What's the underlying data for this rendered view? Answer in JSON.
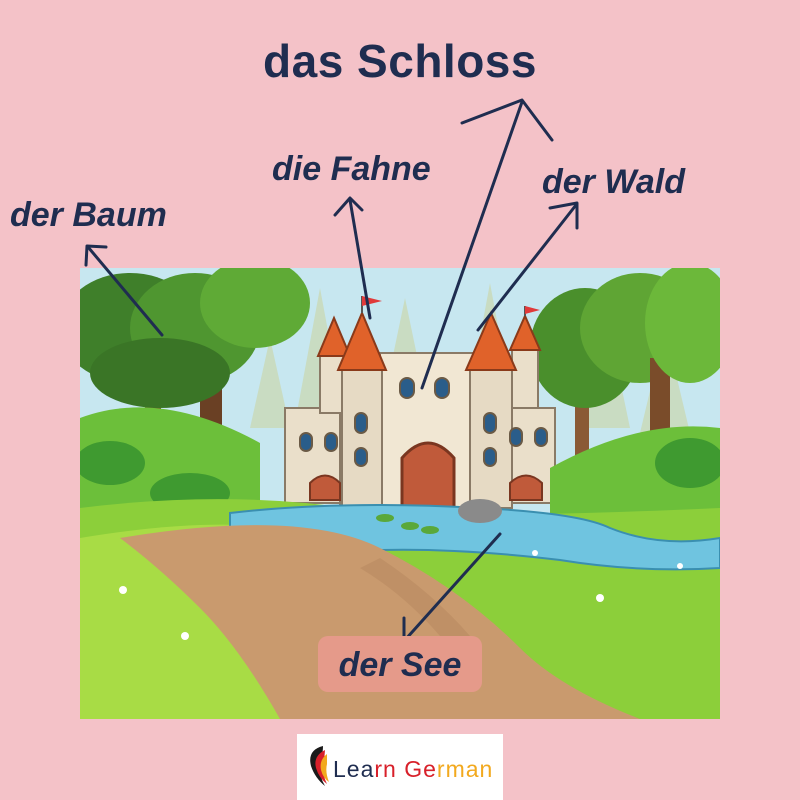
{
  "title": "das Schloss",
  "labels": {
    "flag": "die Fahne",
    "forest": "der Wald",
    "tree": "der Baum",
    "lake": "der See"
  },
  "logo": {
    "part1": "Lea",
    "part2": "rn Ge",
    "part3": "rman"
  },
  "colors": {
    "background": "#f4c2c8",
    "label_text": "#1f2d50",
    "lake_box": "#e59a8a",
    "castle_roof": "#e0622a",
    "grass": "#8ccf3a",
    "water": "#6fc4e0"
  },
  "icons": [
    "german-flag-heart-icon"
  ]
}
